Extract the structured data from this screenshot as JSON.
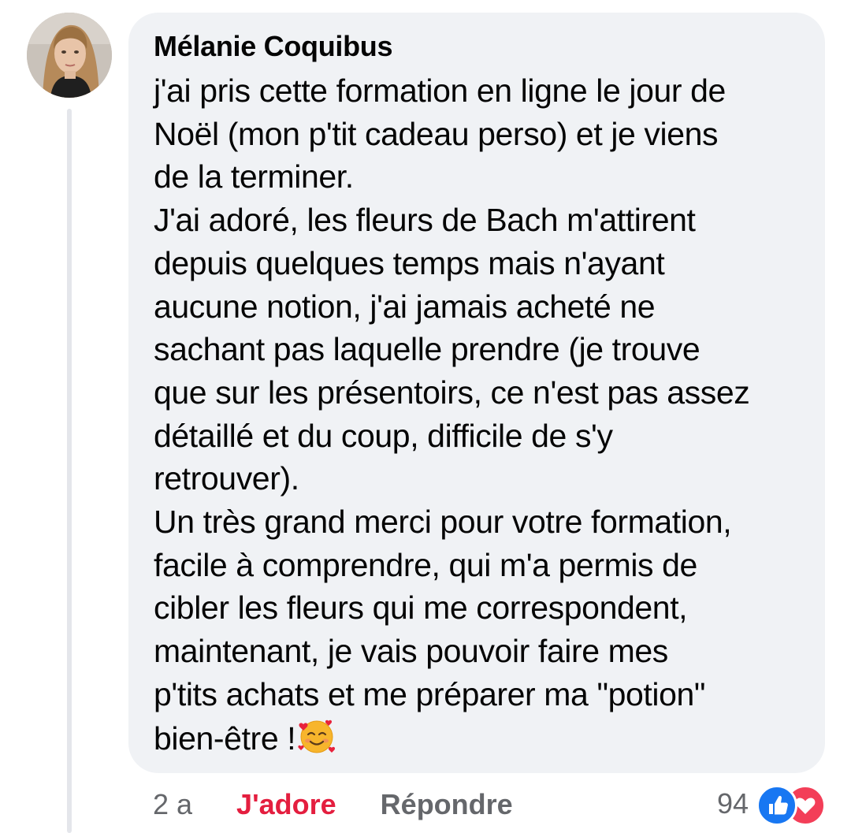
{
  "comment": {
    "author": "Mélanie Coquibus",
    "body": "j'ai pris cette formation en ligne le jour de\nNoël (mon p'tit cadeau perso) et je viens\nde la terminer.\nJ'ai adoré, les fleurs de Bach m'attirent\ndepuis quelques temps mais n'ayant\naucune notion, j'ai jamais acheté ne\nsachant pas laquelle prendre (je trouve\nque sur les présentoirs, ce n'est pas assez\ndétaillé et du coup, difficile de s'y\nretrouver).\nUn très grand merci pour votre formation,\nfacile à comprendre, qui m'a permis de\ncibler les fleurs qui me correspondent,\nmaintenant, je vais pouvoir faire mes\np'tits achats et me préparer ma \"potion\"\nbien-être !",
    "emoji": "smiling-face-with-hearts"
  },
  "actions": {
    "time": "2 a",
    "reaction_label": "J'adore",
    "reply_label": "Répondre"
  },
  "reactions": {
    "count": "94",
    "icons": [
      "like",
      "love"
    ]
  },
  "colors": {
    "bubble": "#f0f2f5",
    "love": "#e41e3f",
    "like": "#1877f2",
    "heart": "#f33e58",
    "muted": "#65676b"
  }
}
